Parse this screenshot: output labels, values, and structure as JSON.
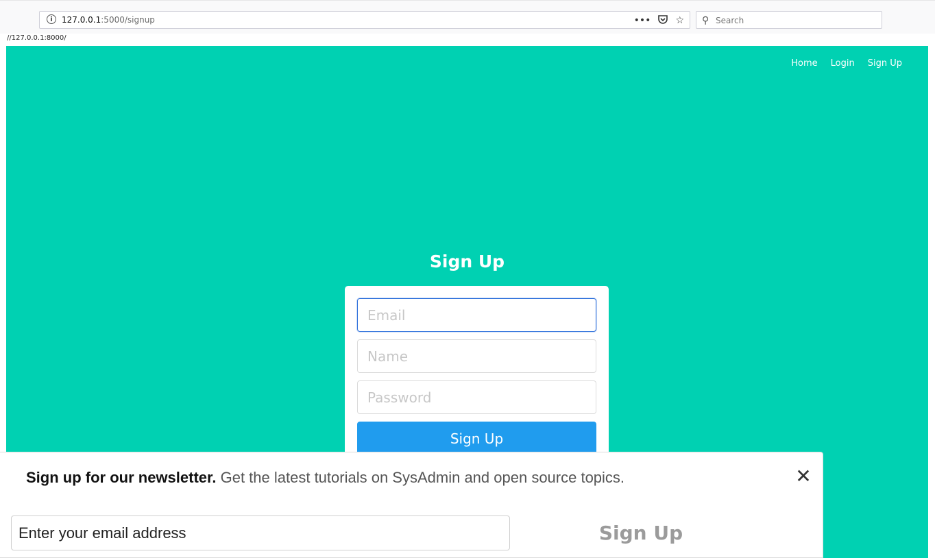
{
  "browser": {
    "url_host": "127.0.0.1",
    "url_path": ":5000/signup",
    "info_icon": "info-icon",
    "more_label": "•••",
    "search_placeholder": "Search",
    "status_url": "//127.0.0.1:8000/"
  },
  "nav": {
    "items": [
      "Home",
      "Login",
      "Sign Up"
    ]
  },
  "signup": {
    "title": "Sign Up",
    "email_placeholder": "Email",
    "name_placeholder": "Name",
    "password_placeholder": "Password",
    "button_label": "Sign Up"
  },
  "newsletter": {
    "headline": "Sign up for our newsletter.",
    "description": "Get the latest tutorials on SysAdmin and open source topics.",
    "email_placeholder": "Enter your email address",
    "button_label": "Sign Up",
    "close_icon": "close-icon"
  },
  "colors": {
    "page_bg": "#00d1b2",
    "button_bg": "#209cee"
  }
}
